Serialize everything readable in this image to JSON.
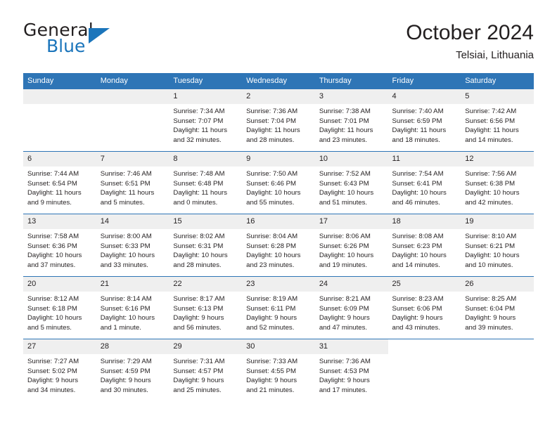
{
  "logo": {
    "word_one": "General",
    "word_two": "Blue",
    "mark": "triangle-mark",
    "brand_color": "#1b75bb"
  },
  "header": {
    "title": "October 2024",
    "location": "Telsiai, Lithuania"
  },
  "theme": {
    "header_blue": "#2e75b6",
    "row_gray": "#efefef",
    "text": "#231f20"
  },
  "weekday_headers": [
    "Sunday",
    "Monday",
    "Tuesday",
    "Wednesday",
    "Thursday",
    "Friday",
    "Saturday"
  ],
  "labels": {
    "sunrise_prefix": "Sunrise:",
    "sunset_prefix": "Sunset:",
    "daylight_prefix": "Daylight:"
  },
  "weeks": [
    [
      {
        "day": "",
        "sunrise": "",
        "sunset": "",
        "daylight_line1": "",
        "daylight_line2": "",
        "blank": true
      },
      {
        "day": "",
        "sunrise": "",
        "sunset": "",
        "daylight_line1": "",
        "daylight_line2": "",
        "blank": true
      },
      {
        "day": "1",
        "sunrise": "Sunrise: 7:34 AM",
        "sunset": "Sunset: 7:07 PM",
        "daylight_line1": "Daylight: 11 hours",
        "daylight_line2": "and 32 minutes."
      },
      {
        "day": "2",
        "sunrise": "Sunrise: 7:36 AM",
        "sunset": "Sunset: 7:04 PM",
        "daylight_line1": "Daylight: 11 hours",
        "daylight_line2": "and 28 minutes."
      },
      {
        "day": "3",
        "sunrise": "Sunrise: 7:38 AM",
        "sunset": "Sunset: 7:01 PM",
        "daylight_line1": "Daylight: 11 hours",
        "daylight_line2": "and 23 minutes."
      },
      {
        "day": "4",
        "sunrise": "Sunrise: 7:40 AM",
        "sunset": "Sunset: 6:59 PM",
        "daylight_line1": "Daylight: 11 hours",
        "daylight_line2": "and 18 minutes."
      },
      {
        "day": "5",
        "sunrise": "Sunrise: 7:42 AM",
        "sunset": "Sunset: 6:56 PM",
        "daylight_line1": "Daylight: 11 hours",
        "daylight_line2": "and 14 minutes."
      }
    ],
    [
      {
        "day": "6",
        "sunrise": "Sunrise: 7:44 AM",
        "sunset": "Sunset: 6:54 PM",
        "daylight_line1": "Daylight: 11 hours",
        "daylight_line2": "and 9 minutes."
      },
      {
        "day": "7",
        "sunrise": "Sunrise: 7:46 AM",
        "sunset": "Sunset: 6:51 PM",
        "daylight_line1": "Daylight: 11 hours",
        "daylight_line2": "and 5 minutes."
      },
      {
        "day": "8",
        "sunrise": "Sunrise: 7:48 AM",
        "sunset": "Sunset: 6:48 PM",
        "daylight_line1": "Daylight: 11 hours",
        "daylight_line2": "and 0 minutes."
      },
      {
        "day": "9",
        "sunrise": "Sunrise: 7:50 AM",
        "sunset": "Sunset: 6:46 PM",
        "daylight_line1": "Daylight: 10 hours",
        "daylight_line2": "and 55 minutes."
      },
      {
        "day": "10",
        "sunrise": "Sunrise: 7:52 AM",
        "sunset": "Sunset: 6:43 PM",
        "daylight_line1": "Daylight: 10 hours",
        "daylight_line2": "and 51 minutes."
      },
      {
        "day": "11",
        "sunrise": "Sunrise: 7:54 AM",
        "sunset": "Sunset: 6:41 PM",
        "daylight_line1": "Daylight: 10 hours",
        "daylight_line2": "and 46 minutes."
      },
      {
        "day": "12",
        "sunrise": "Sunrise: 7:56 AM",
        "sunset": "Sunset: 6:38 PM",
        "daylight_line1": "Daylight: 10 hours",
        "daylight_line2": "and 42 minutes."
      }
    ],
    [
      {
        "day": "13",
        "sunrise": "Sunrise: 7:58 AM",
        "sunset": "Sunset: 6:36 PM",
        "daylight_line1": "Daylight: 10 hours",
        "daylight_line2": "and 37 minutes."
      },
      {
        "day": "14",
        "sunrise": "Sunrise: 8:00 AM",
        "sunset": "Sunset: 6:33 PM",
        "daylight_line1": "Daylight: 10 hours",
        "daylight_line2": "and 33 minutes."
      },
      {
        "day": "15",
        "sunrise": "Sunrise: 8:02 AM",
        "sunset": "Sunset: 6:31 PM",
        "daylight_line1": "Daylight: 10 hours",
        "daylight_line2": "and 28 minutes."
      },
      {
        "day": "16",
        "sunrise": "Sunrise: 8:04 AM",
        "sunset": "Sunset: 6:28 PM",
        "daylight_line1": "Daylight: 10 hours",
        "daylight_line2": "and 23 minutes."
      },
      {
        "day": "17",
        "sunrise": "Sunrise: 8:06 AM",
        "sunset": "Sunset: 6:26 PM",
        "daylight_line1": "Daylight: 10 hours",
        "daylight_line2": "and 19 minutes."
      },
      {
        "day": "18",
        "sunrise": "Sunrise: 8:08 AM",
        "sunset": "Sunset: 6:23 PM",
        "daylight_line1": "Daylight: 10 hours",
        "daylight_line2": "and 14 minutes."
      },
      {
        "day": "19",
        "sunrise": "Sunrise: 8:10 AM",
        "sunset": "Sunset: 6:21 PM",
        "daylight_line1": "Daylight: 10 hours",
        "daylight_line2": "and 10 minutes."
      }
    ],
    [
      {
        "day": "20",
        "sunrise": "Sunrise: 8:12 AM",
        "sunset": "Sunset: 6:18 PM",
        "daylight_line1": "Daylight: 10 hours",
        "daylight_line2": "and 5 minutes."
      },
      {
        "day": "21",
        "sunrise": "Sunrise: 8:14 AM",
        "sunset": "Sunset: 6:16 PM",
        "daylight_line1": "Daylight: 10 hours",
        "daylight_line2": "and 1 minute."
      },
      {
        "day": "22",
        "sunrise": "Sunrise: 8:17 AM",
        "sunset": "Sunset: 6:13 PM",
        "daylight_line1": "Daylight: 9 hours",
        "daylight_line2": "and 56 minutes."
      },
      {
        "day": "23",
        "sunrise": "Sunrise: 8:19 AM",
        "sunset": "Sunset: 6:11 PM",
        "daylight_line1": "Daylight: 9 hours",
        "daylight_line2": "and 52 minutes."
      },
      {
        "day": "24",
        "sunrise": "Sunrise: 8:21 AM",
        "sunset": "Sunset: 6:09 PM",
        "daylight_line1": "Daylight: 9 hours",
        "daylight_line2": "and 47 minutes."
      },
      {
        "day": "25",
        "sunrise": "Sunrise: 8:23 AM",
        "sunset": "Sunset: 6:06 PM",
        "daylight_line1": "Daylight: 9 hours",
        "daylight_line2": "and 43 minutes."
      },
      {
        "day": "26",
        "sunrise": "Sunrise: 8:25 AM",
        "sunset": "Sunset: 6:04 PM",
        "daylight_line1": "Daylight: 9 hours",
        "daylight_line2": "and 39 minutes."
      }
    ],
    [
      {
        "day": "27",
        "sunrise": "Sunrise: 7:27 AM",
        "sunset": "Sunset: 5:02 PM",
        "daylight_line1": "Daylight: 9 hours",
        "daylight_line2": "and 34 minutes."
      },
      {
        "day": "28",
        "sunrise": "Sunrise: 7:29 AM",
        "sunset": "Sunset: 4:59 PM",
        "daylight_line1": "Daylight: 9 hours",
        "daylight_line2": "and 30 minutes."
      },
      {
        "day": "29",
        "sunrise": "Sunrise: 7:31 AM",
        "sunset": "Sunset: 4:57 PM",
        "daylight_line1": "Daylight: 9 hours",
        "daylight_line2": "and 25 minutes."
      },
      {
        "day": "30",
        "sunrise": "Sunrise: 7:33 AM",
        "sunset": "Sunset: 4:55 PM",
        "daylight_line1": "Daylight: 9 hours",
        "daylight_line2": "and 21 minutes."
      },
      {
        "day": "31",
        "sunrise": "Sunrise: 7:36 AM",
        "sunset": "Sunset: 4:53 PM",
        "daylight_line1": "Daylight: 9 hours",
        "daylight_line2": "and 17 minutes."
      },
      {
        "day": "",
        "sunrise": "",
        "sunset": "",
        "daylight_line1": "",
        "daylight_line2": "",
        "nodata": true
      },
      {
        "day": "",
        "sunrise": "",
        "sunset": "",
        "daylight_line1": "",
        "daylight_line2": "",
        "nodata": true
      }
    ]
  ]
}
